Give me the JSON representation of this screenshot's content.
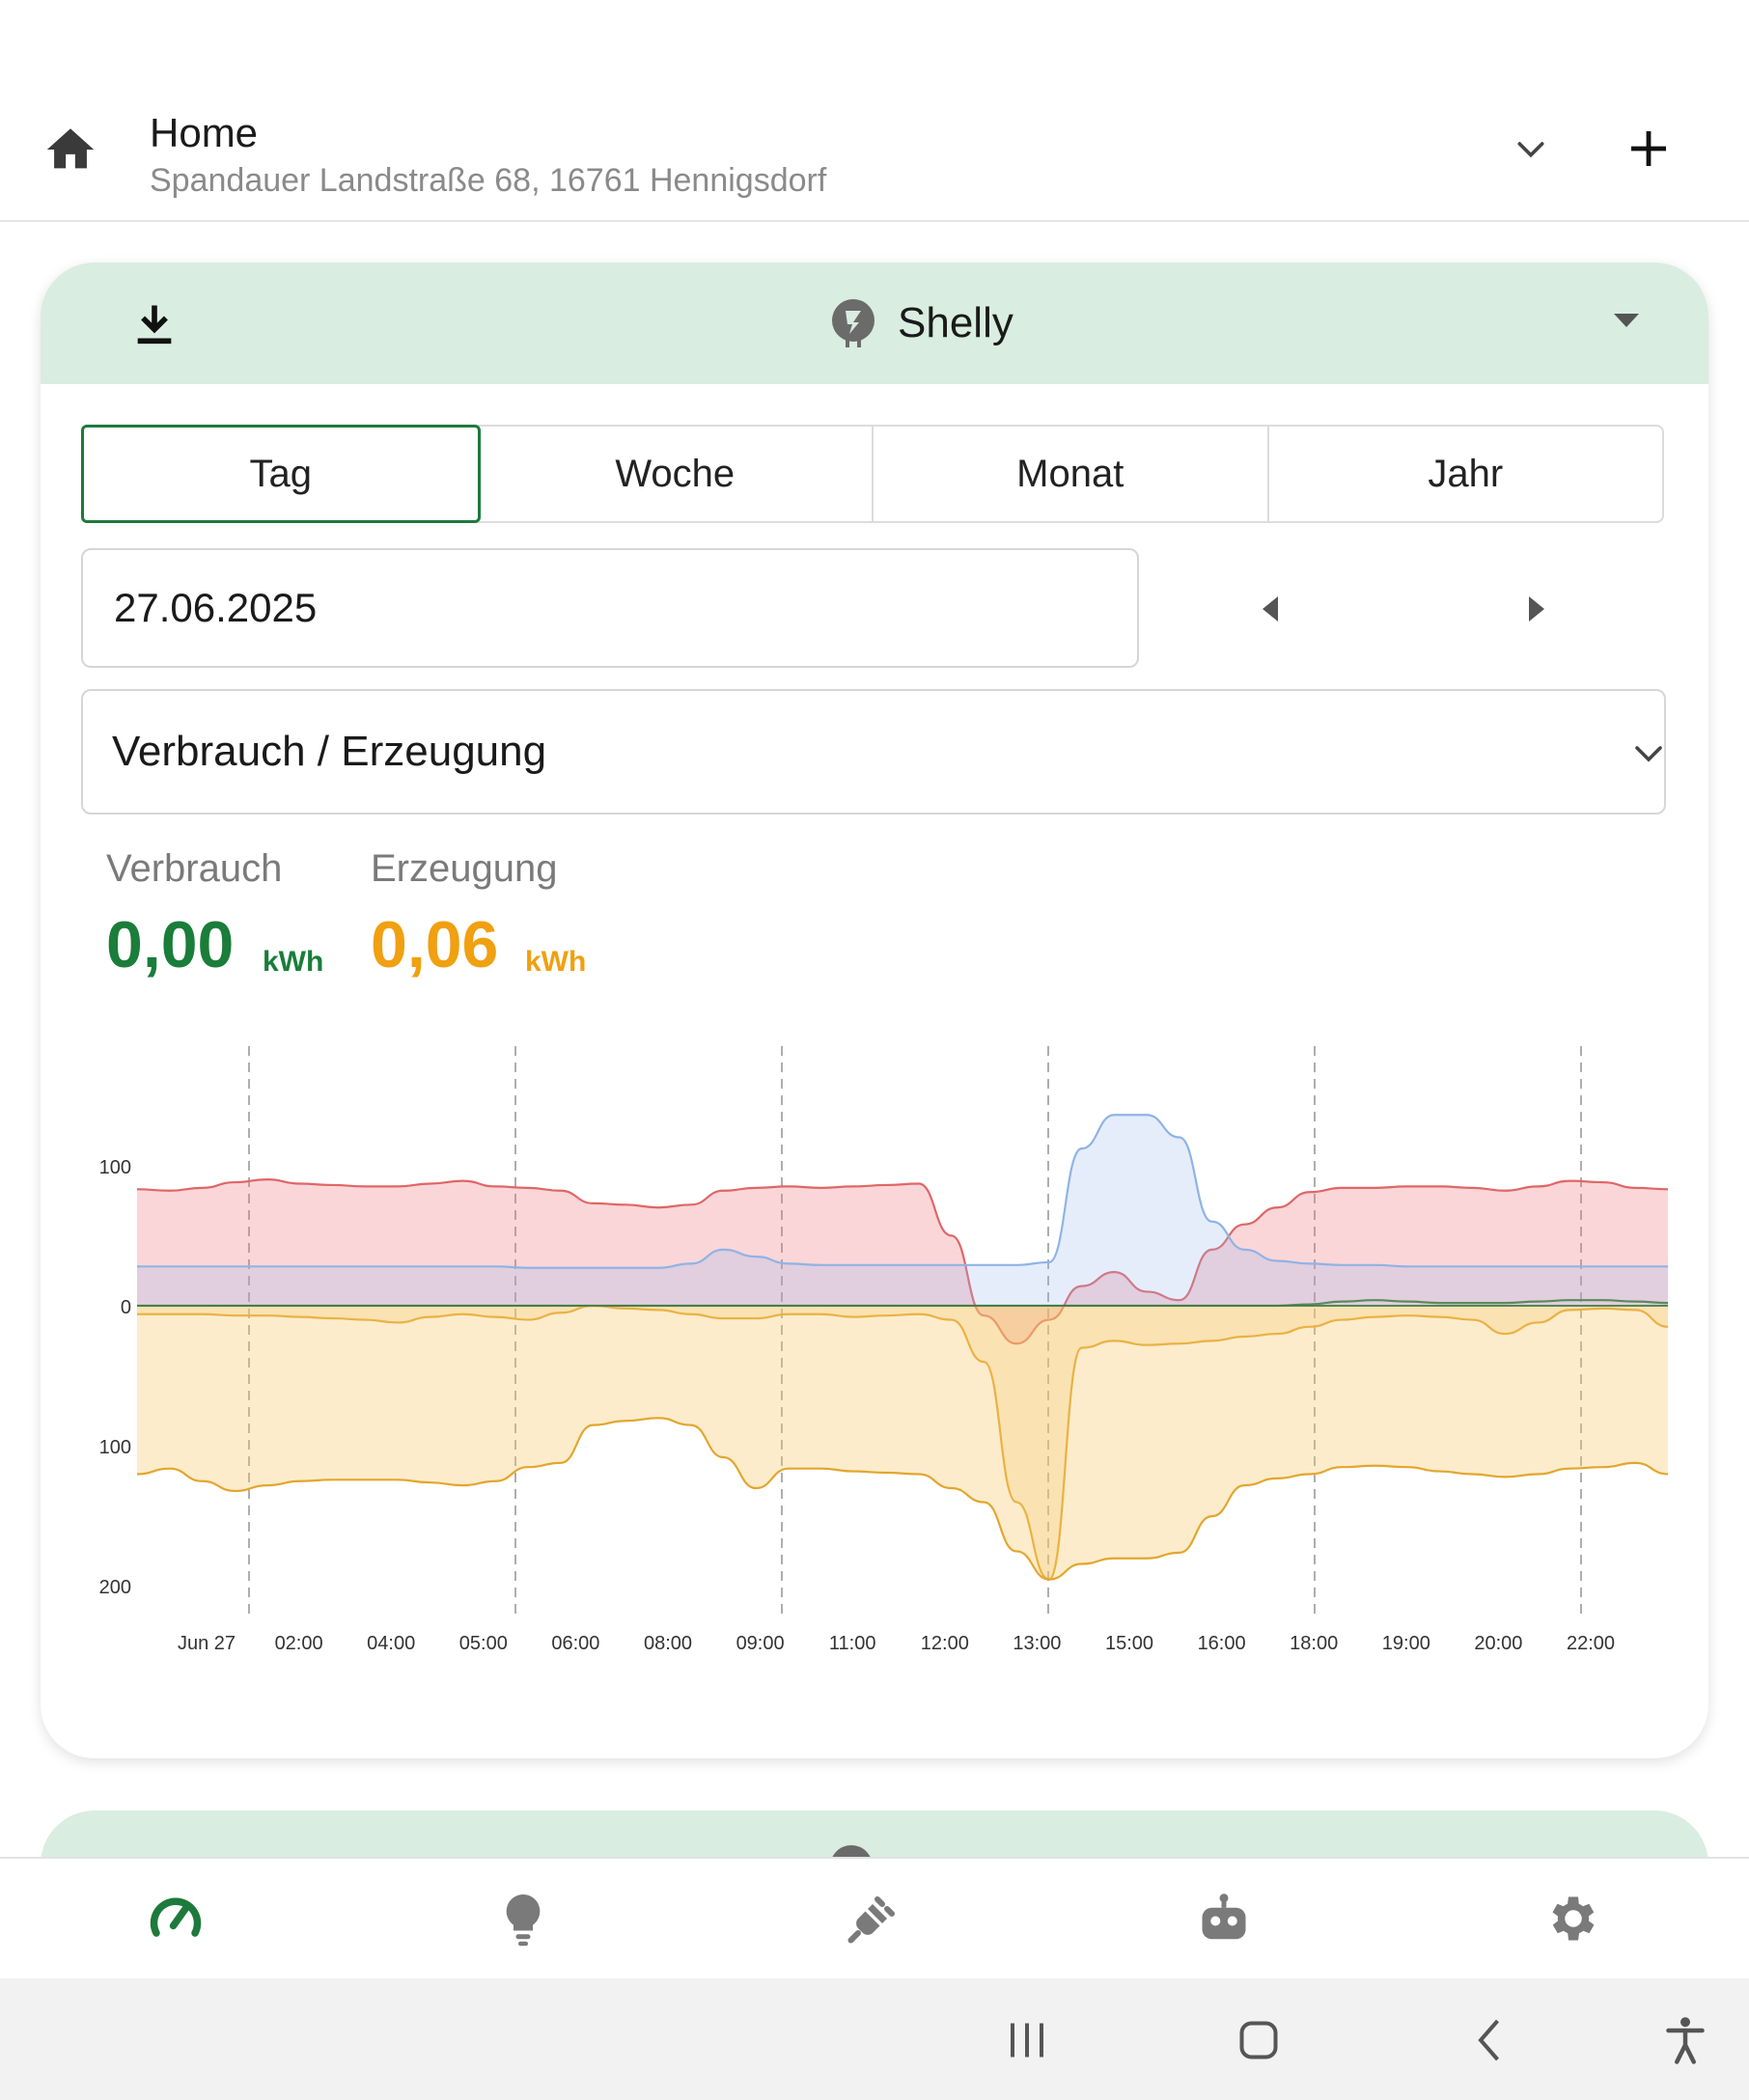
{
  "header": {
    "title": "Home",
    "address": "Spandauer Landstraße 68, 16761 Hennigsdorf"
  },
  "device": {
    "name": "Shelly"
  },
  "tabs": [
    {
      "label": "Tag",
      "active": true
    },
    {
      "label": "Woche",
      "active": false
    },
    {
      "label": "Monat",
      "active": false
    },
    {
      "label": "Jahr",
      "active": false
    }
  ],
  "date": {
    "value": "27.06.2025"
  },
  "view_select": {
    "value": "Verbrauch / Erzeugung"
  },
  "stats": {
    "consumption": {
      "label": "Verbrauch",
      "value": "0,00",
      "unit": "kWh",
      "color": "#1a7d3a"
    },
    "production": {
      "label": "Erzeugung",
      "value": "0,06",
      "unit": "kWh",
      "color": "#f0a010"
    }
  },
  "colors": {
    "accent": "#1e7a3c",
    "card_header": "#d9ede0",
    "red_series": "#e06666",
    "blue_series": "#8fb3e6",
    "orange_series": "#e3a62d",
    "green_series": "#5a8a5a"
  },
  "chart_data": {
    "type": "area",
    "x_labels": [
      "Jun 27",
      "02:00",
      "04:00",
      "05:00",
      "06:00",
      "08:00",
      "09:00",
      "11:00",
      "12:00",
      "13:00",
      "15:00",
      "16:00",
      "18:00",
      "19:00",
      "20:00",
      "22:00"
    ],
    "y_ticks": [
      "100",
      "0",
      "100",
      "200"
    ],
    "ylim": [
      -200,
      165
    ],
    "grid": "vertical-dashed",
    "t": [
      0,
      0.5,
      1,
      1.5,
      2,
      2.5,
      3,
      3.5,
      4,
      4.5,
      5,
      5.5,
      6,
      6.5,
      7,
      7.5,
      8,
      8.5,
      9,
      9.5,
      10,
      10.5,
      11,
      11.5,
      12,
      12.5,
      13,
      13.5,
      14,
      14.5,
      15,
      15.5,
      16,
      16.5,
      17,
      17.5,
      18,
      18.5,
      19,
      19.5,
      20,
      20.5,
      21,
      21.5,
      22,
      22.5,
      23,
      23.5
    ],
    "series": [
      {
        "values": [
          83,
          82,
          84,
          88,
          90,
          87,
          86,
          85,
          85,
          87,
          89,
          85,
          84,
          82,
          73,
          72,
          70,
          72,
          82,
          84,
          85,
          84,
          85,
          86,
          87,
          50,
          -7,
          -27,
          -10,
          14,
          24,
          10,
          4,
          40,
          58,
          70,
          81,
          84,
          84,
          85,
          85,
          84,
          82,
          85,
          89,
          88,
          84,
          83
        ]
      },
      {
        "values": [
          28,
          28,
          28,
          28,
          28,
          28,
          28,
          28,
          28,
          28,
          28,
          28,
          27,
          27,
          27,
          27,
          27,
          30,
          40,
          35,
          30,
          29,
          29,
          29,
          29,
          29,
          29,
          29,
          31,
          112,
          136,
          136,
          120,
          60,
          40,
          32,
          30,
          29,
          29,
          28,
          28,
          28,
          28,
          28,
          28,
          28,
          28,
          28
        ]
      },
      {
        "values": [
          0,
          0,
          0,
          0,
          0,
          0,
          0,
          0,
          0,
          0,
          0,
          0,
          0,
          0,
          0,
          0,
          0,
          0,
          0,
          0,
          0,
          0,
          0,
          0,
          0,
          0,
          0,
          0,
          0,
          0,
          0,
          0,
          0,
          0,
          0,
          0,
          1,
          3,
          4,
          3,
          2,
          2,
          2,
          3,
          4,
          4,
          3,
          2
        ]
      },
      {
        "values": [
          -6,
          -6,
          -6,
          -7,
          -7,
          -8,
          -9,
          -10,
          -12,
          -8,
          -6,
          -8,
          -10,
          -5,
          0,
          -2,
          -3,
          -6,
          -9,
          -9,
          -6,
          -6,
          -8,
          -7,
          -6,
          -10,
          -40,
          -140,
          -195,
          -30,
          -25,
          -28,
          -27,
          -25,
          -22,
          -20,
          -15,
          -10,
          -8,
          -7,
          -8,
          -10,
          -20,
          -12,
          -3,
          -2,
          -3,
          -15
        ]
      },
      {
        "values": [
          -120,
          -116,
          -125,
          -132,
          -128,
          -125,
          -124,
          -124,
          -124,
          -126,
          -128,
          -125,
          -115,
          -112,
          -85,
          -82,
          -80,
          -85,
          -108,
          -130,
          -116,
          -116,
          -118,
          -119,
          -120,
          -130,
          -140,
          -175,
          -195,
          -184,
          -180,
          -180,
          -176,
          -150,
          -128,
          -123,
          -120,
          -115,
          -114,
          -115,
          -118,
          -120,
          -122,
          -120,
          -116,
          -115,
          -112,
          -120
        ]
      }
    ]
  },
  "nav": {
    "items": [
      {
        "icon": "gauge-icon",
        "active": true
      },
      {
        "icon": "lightbulb-icon",
        "active": false
      },
      {
        "icon": "plug-icon",
        "active": false
      },
      {
        "icon": "robot-icon",
        "active": false
      },
      {
        "icon": "gear-icon",
        "active": false
      }
    ]
  }
}
